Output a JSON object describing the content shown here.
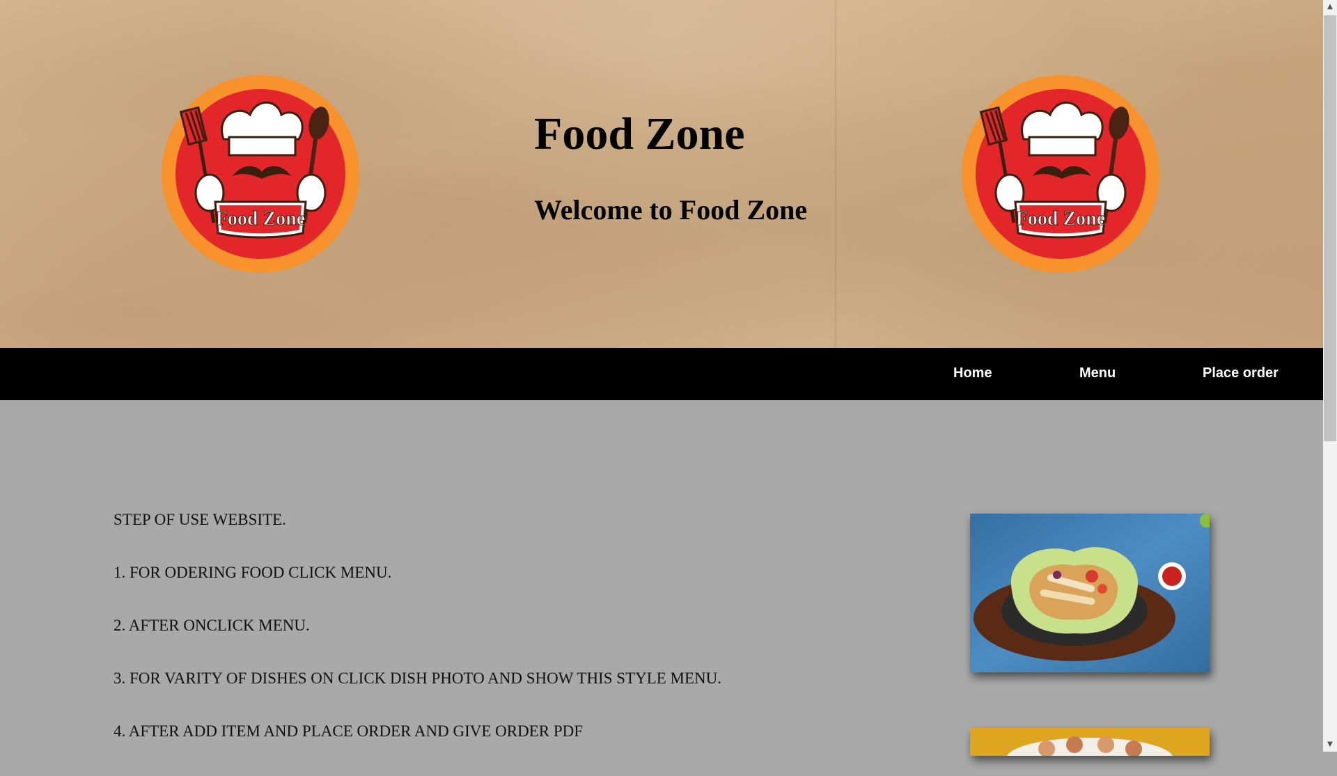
{
  "header": {
    "title": "Food Zone",
    "subtitle": "Welcome to Food Zone",
    "logo_text": "Food Zone"
  },
  "nav": {
    "items": [
      {
        "label": "Home"
      },
      {
        "label": "Menu"
      },
      {
        "label": "Place order"
      }
    ]
  },
  "content": {
    "steps": [
      "STEP OF USE WEBSITE.",
      "1. FOR ODERING FOOD CLICK MENU.",
      "2. AFTER ONCLICK MENU.",
      "3. FOR VARITY OF DISHES ON CLICK DISH PHOTO AND SHOW THIS STYLE MENU.",
      "4. AFTER ADD ITEM AND PLACE ORDER AND GIVE ORDER PDF"
    ]
  },
  "colors": {
    "nav_bg": "#000000",
    "content_bg": "#a9a9a9",
    "logo_orange": "#f7922d",
    "logo_red": "#e3262a"
  },
  "icons": {
    "scroll_up": "▲",
    "scroll_down": "▼"
  }
}
